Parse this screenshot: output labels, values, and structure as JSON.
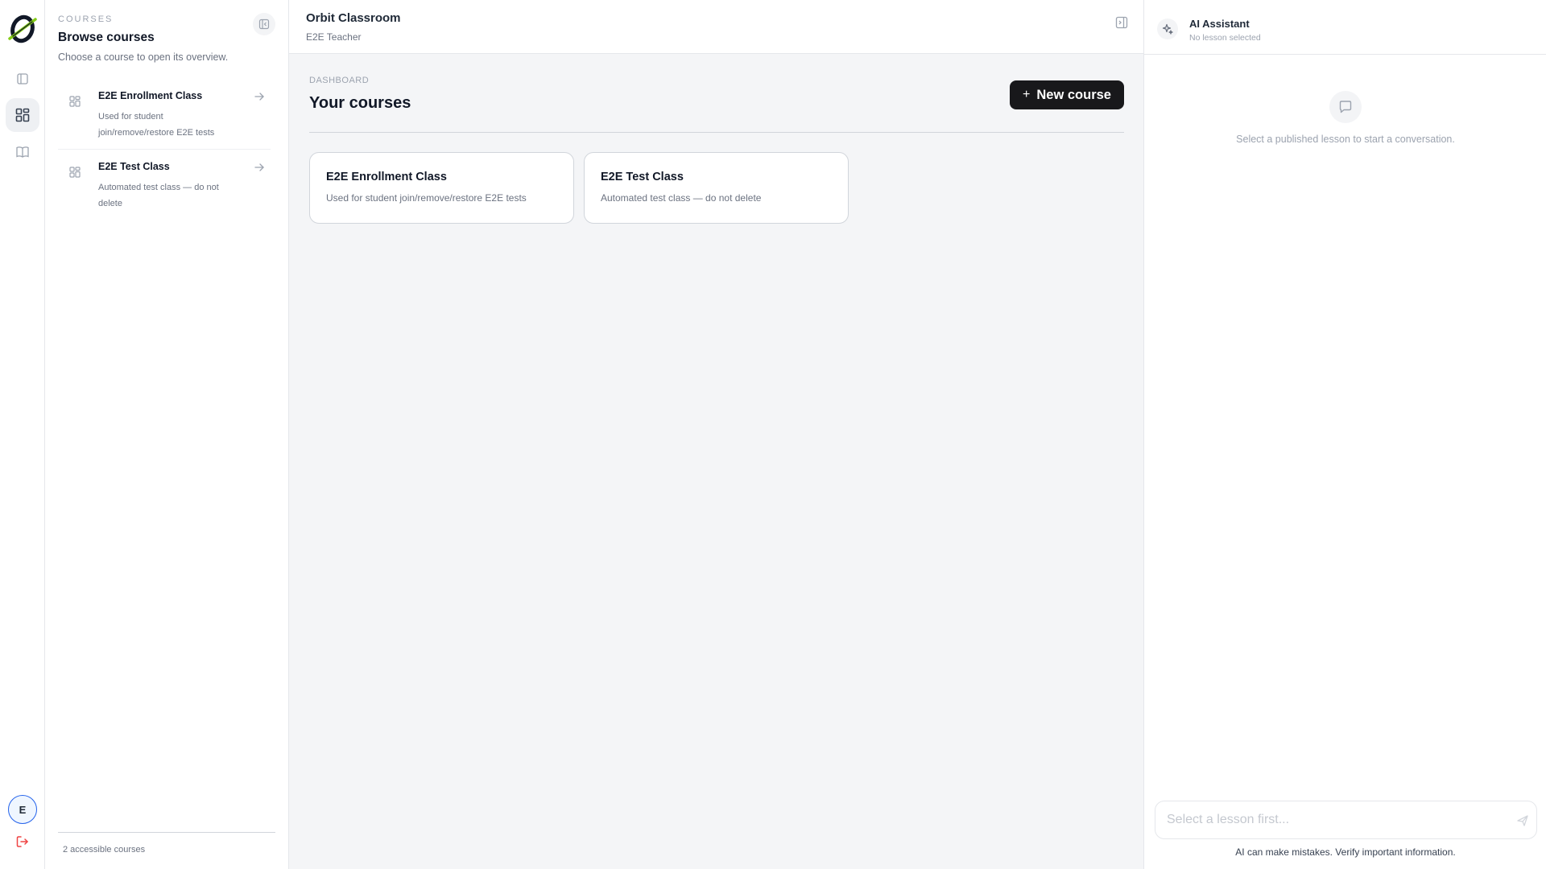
{
  "rail": {
    "avatar_initial": "E"
  },
  "courses_panel": {
    "eyebrow": "COURSES",
    "title": "Browse courses",
    "subtitle": "Choose a course to open its overview.",
    "items": [
      {
        "name": "E2E Enrollment Class",
        "description": "Used for student join/remove/restore E2E tests"
      },
      {
        "name": "E2E Test Class",
        "description": "Automated test class — do not delete"
      }
    ],
    "footer": "2 accessible courses"
  },
  "header": {
    "title": "Orbit Classroom",
    "subtitle": "E2E Teacher"
  },
  "dashboard": {
    "eyebrow": "DASHBOARD",
    "title": "Your courses",
    "new_button_icon": "+",
    "new_button_label": "New course",
    "cards": [
      {
        "name": "E2E Enrollment Class",
        "description": "Used for student join/remove/restore E2E tests"
      },
      {
        "name": "E2E Test Class",
        "description": "Automated test class — do not delete"
      }
    ]
  },
  "assistant": {
    "title": "AI Assistant",
    "subtitle": "No lesson selected",
    "empty_message": "Select a published lesson to start a conversation.",
    "input_placeholder": "Select a lesson first...",
    "disclaimer": "AI can make mistakes. Verify important information."
  },
  "colors": {
    "primary_button": "#18181b",
    "avatar_border": "#2563eb",
    "logout_icon": "#ef4444",
    "logo_accent": "#84cc16",
    "main_background": "#f4f5f7"
  }
}
